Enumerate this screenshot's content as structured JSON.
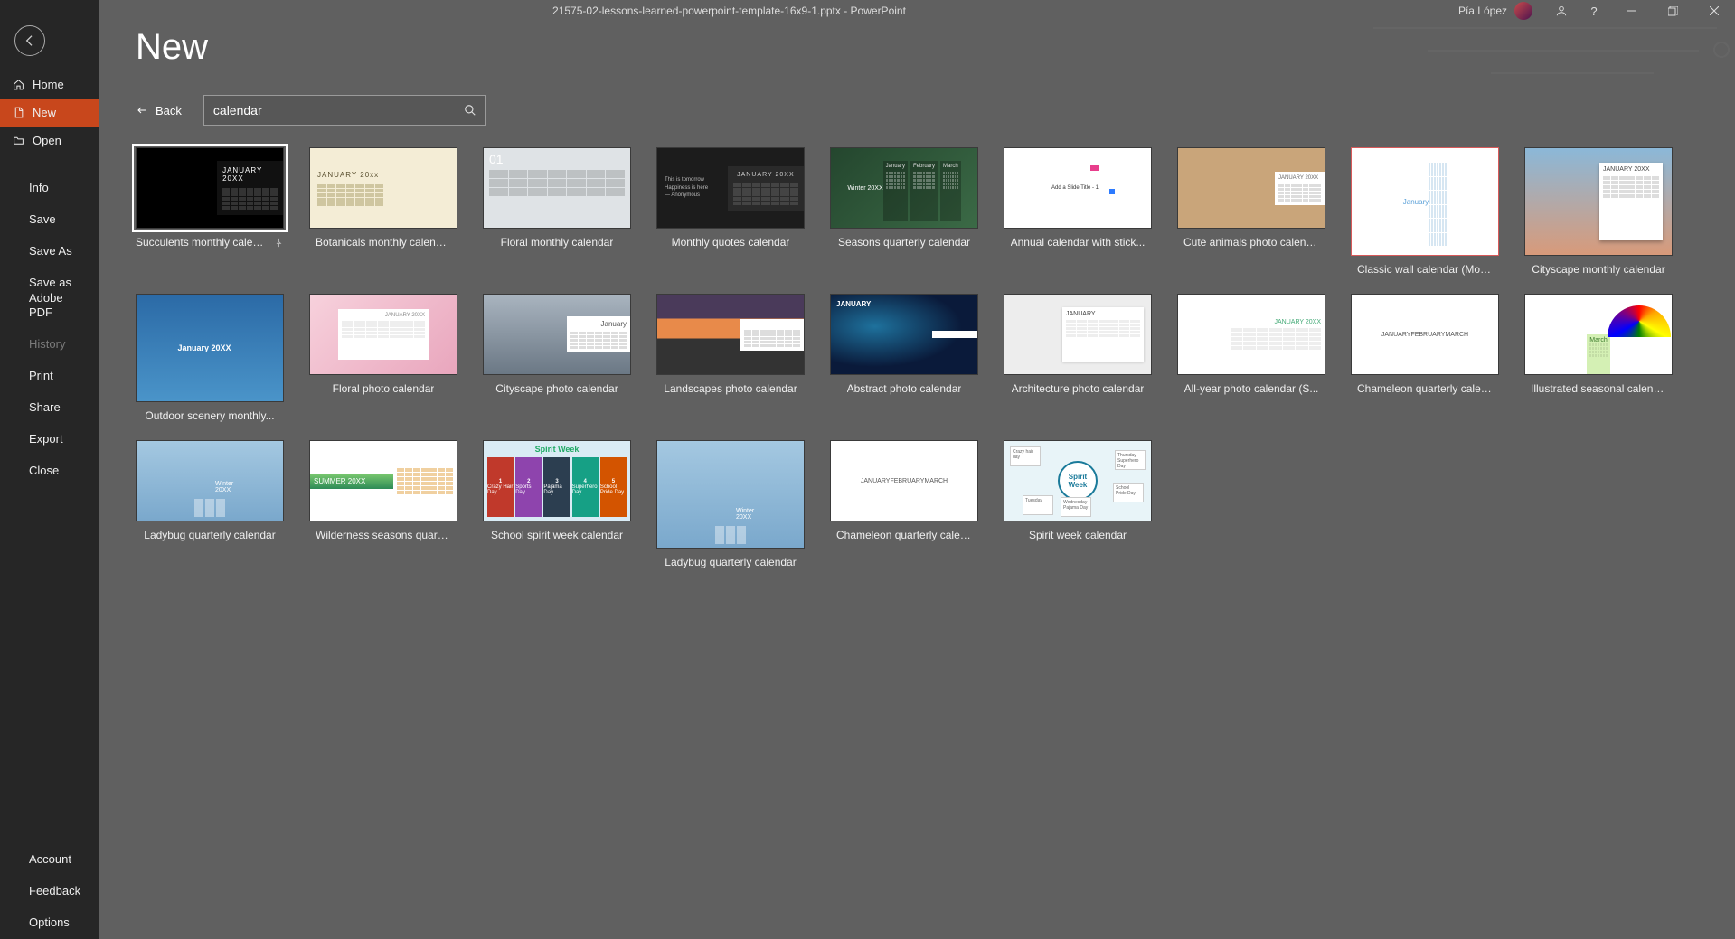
{
  "titlebar": {
    "document_title": "21575-02-lessons-learned-powerpoint-template-16x9-1.pptx  -  PowerPoint",
    "user_name": "Pía López"
  },
  "sidebar": {
    "nav": [
      {
        "id": "home",
        "label": "Home"
      },
      {
        "id": "new",
        "label": "New"
      },
      {
        "id": "open",
        "label": "Open"
      }
    ],
    "sub": [
      {
        "id": "info",
        "label": "Info"
      },
      {
        "id": "save",
        "label": "Save"
      },
      {
        "id": "saveas",
        "label": "Save As"
      },
      {
        "id": "saveaspdf",
        "label": "Save as Adobe PDF"
      },
      {
        "id": "history",
        "label": "History",
        "disabled": true
      },
      {
        "id": "print",
        "label": "Print"
      },
      {
        "id": "share",
        "label": "Share"
      },
      {
        "id": "export",
        "label": "Export"
      },
      {
        "id": "close",
        "label": "Close"
      }
    ],
    "bottom": [
      {
        "id": "account",
        "label": "Account"
      },
      {
        "id": "feedback",
        "label": "Feedback"
      },
      {
        "id": "options",
        "label": "Options"
      }
    ]
  },
  "page": {
    "heading": "New",
    "back_label": "Back",
    "search_value": "calendar"
  },
  "thumbtext": {
    "succulents_month": "JANUARY 20XX",
    "botanicals_month": "JANUARY 20xx",
    "floral_day": "01",
    "quotes_month": "JANUARY 20XX",
    "seasons_header": "Winter 20XX",
    "seasons_m1": "January",
    "seasons_m2": "February",
    "seasons_m3": "March",
    "annual_header": "Add a Slide Title - 1",
    "cute_month": "JANUARY 20XX",
    "classic_month": "January",
    "cityscape_month": "JANUARY 20XX",
    "outdoor_month": "January 20XX",
    "floralphoto_month": "JANUARY 20XX",
    "cityphoto_month": "January",
    "abstract_month": "JANUARY",
    "arch_month": "JANUARY",
    "allyear_month": "JANUARY 20XX",
    "cham_m1": "JANUARY",
    "cham_m2": "FEBRUARY",
    "cham_m3": "MARCH",
    "illus_month": "March",
    "lady_header": "Winter 20XX",
    "wild_header": "SUMMER 20XX",
    "spirit_header": "Spirit Week",
    "spirit_d1n": "1",
    "spirit_d2n": "2",
    "spirit_d3n": "3",
    "spirit_d4n": "4",
    "spirit_d5n": "5",
    "spirit_d1": "Crazy Hair Day",
    "spirit_d2": "Sports Day",
    "spirit_d3": "Pajama Day",
    "spirit_d4": "Superhero Day",
    "spirit_d5": "School Pride Day",
    "spw_center": "Spirit Week",
    "spw_n1": "Crazy hair day",
    "spw_n2": "Tuesday",
    "spw_n3": "Wednesday Pajama Day",
    "spw_n4": "Thursday Superhero Day",
    "spw_n5": "School Pride Day"
  },
  "templates": [
    {
      "id": "succulents",
      "label": "Succulents monthly calendar",
      "selected": true,
      "pinned": true,
      "style": "t-succ",
      "tall": false
    },
    {
      "id": "botanicals",
      "label": "Botanicals monthly calendar",
      "style": "t-bot",
      "tall": false
    },
    {
      "id": "floralmonth",
      "label": "Floral monthly calendar",
      "style": "t-flo",
      "tall": false
    },
    {
      "id": "quotes",
      "label": "Monthly quotes calendar",
      "style": "t-quo",
      "tall": false
    },
    {
      "id": "seasons",
      "label": "Seasons quarterly calendar",
      "style": "t-sea",
      "tall": false
    },
    {
      "id": "annual",
      "label": "Annual calendar with stick...",
      "style": "t-ann",
      "tall": false
    },
    {
      "id": "cute",
      "label": "Cute animals photo calendar",
      "style": "t-cute",
      "tall": false
    },
    {
      "id": "classic",
      "label": "Classic wall calendar (Mon-...",
      "style": "t-classic",
      "tall": true
    },
    {
      "id": "cityscape",
      "label": "Cityscape monthly calendar",
      "style": "t-city",
      "tall": true
    },
    {
      "id": "outdoor",
      "label": "Outdoor scenery monthly...",
      "style": "t-out",
      "tall": true
    },
    {
      "id": "floralphoto",
      "label": "Floral photo calendar",
      "style": "t-pink",
      "tall": false
    },
    {
      "id": "cityphoto",
      "label": "Cityscape photo calendar",
      "style": "t-cityp",
      "tall": false
    },
    {
      "id": "landscapes",
      "label": "Landscapes photo calendar",
      "style": "t-land",
      "tall": false
    },
    {
      "id": "abstract",
      "label": "Abstract photo calendar",
      "style": "t-abs",
      "tall": false
    },
    {
      "id": "architecture",
      "label": "Architecture photo calendar",
      "style": "t-arch",
      "tall": false
    },
    {
      "id": "allyear",
      "label": "All-year photo calendar (S...",
      "style": "t-ally",
      "tall": false
    },
    {
      "id": "chameleonq",
      "label": "Chameleon quarterly calen...",
      "style": "t-cham",
      "tall": false
    },
    {
      "id": "illustrated",
      "label": "Illustrated seasonal calenda...",
      "style": "t-ill",
      "tall": false
    },
    {
      "id": "ladybugq",
      "label": "Ladybug quarterly calendar",
      "style": "t-lady",
      "tall": false
    },
    {
      "id": "wilderness",
      "label": "Wilderness seasons quarter...",
      "style": "t-wild",
      "tall": false
    },
    {
      "id": "schoolspirit",
      "label": "School spirit week calendar",
      "style": "t-spir",
      "tall": false
    },
    {
      "id": "ladybugq2",
      "label": "Ladybug quarterly calendar",
      "style": "t-lady",
      "tall": true
    },
    {
      "id": "chameleonq2",
      "label": "Chameleon quarterly calen...",
      "style": "t-cham",
      "tall": false
    },
    {
      "id": "spiritweek",
      "label": "Spirit week calendar",
      "style": "t-spw",
      "tall": false
    }
  ]
}
